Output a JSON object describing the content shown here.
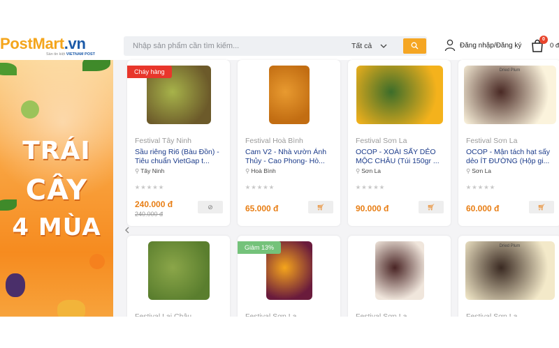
{
  "header": {
    "logo_text_a": "PostMart",
    "logo_text_b": ".vn",
    "logo_sub_pre": "Sàn tin kiệt",
    "logo_sub": "VIETNAM POST",
    "search_placeholder": "Nhập sản phẩm cần tìm kiếm...",
    "category": "Tất cả",
    "account_label": "Đăng nhập/Đăng ký",
    "cart_count": "0",
    "cart_total": "0 đ"
  },
  "banner": {
    "line1": "TRÁI",
    "line2": "CÂY",
    "line3": "4 MÙA"
  },
  "products": [
    {
      "festival": "Festival Tây Ninh",
      "name": "Sầu riêng Ri6 (Bàu Đồn) - Tiêu chuẩn VietGap t...",
      "location": "Tây Ninh",
      "price": "240.000 đ",
      "old_price": "240.000 đ",
      "tag": "Cháy hàng",
      "button": "ban"
    },
    {
      "festival": "Festival Hoà Bình",
      "name": "Cam V2 - Nhà vườn Ánh Thủy - Cao Phong- Hò...",
      "location": "Hoà Bình",
      "price": "65.000 đ",
      "old_price": "",
      "tag": "",
      "button": "cart"
    },
    {
      "festival": "Festival Sơn La",
      "name": "OCOP - XOÀI SẤY DẺO MỘC CHÂU (Túi 150gr ...",
      "location": "Sơn La",
      "price": "90.000 đ",
      "old_price": "",
      "tag": "",
      "button": "cart"
    },
    {
      "festival": "Festival Sơn La",
      "name": "OCOP - Mận tách hạt sấy dẻo ÍT ĐƯỜNG (Hộp gi...",
      "location": "Sơn La",
      "price": "60.000 đ",
      "old_price": "",
      "tag": "",
      "button": "cart"
    },
    {
      "festival": "Festival Lai Châu",
      "tag": ""
    },
    {
      "festival": "Festival Sơn La",
      "tag": "Giảm 13%"
    },
    {
      "festival": "Festival Sơn La",
      "tag": ""
    },
    {
      "festival": "Festival Sơn La",
      "tag": ""
    }
  ],
  "product_images": [
    {
      "label": "",
      "colors": [
        "#6c5a2a",
        "#a7b34a"
      ]
    },
    {
      "label": "",
      "colors": [
        "#c26d12",
        "#e89a30"
      ]
    },
    {
      "label": "",
      "colors": [
        "#f4b21c",
        "#3c6d2a"
      ]
    },
    {
      "label": "Dried Plum",
      "colors": [
        "#fbf3dc",
        "#4a2a25"
      ]
    },
    {
      "label": "",
      "colors": [
        "#5a7e2e",
        "#8ba649"
      ]
    },
    {
      "label": "",
      "colors": [
        "#6a1b3c",
        "#f5a51c"
      ]
    },
    {
      "label": "",
      "colors": [
        "#f0e6dc",
        "#4a2525"
      ]
    },
    {
      "label": "Dried Plum",
      "colors": [
        "#f3e9c9",
        "#3a2a22"
      ]
    }
  ],
  "colors": {
    "brand_orange": "#f4a51c",
    "brand_blue": "#1c5aa8",
    "price": "#e87e14",
    "hot_tag": "#e8362b",
    "sale_tag": "#74c27a"
  },
  "icons": {
    "search": "search-icon",
    "account": "user-icon",
    "cart": "cart-icon",
    "pin": "map-pin-icon",
    "chevron": "chevron-down-icon",
    "arrow": "arrow-left-icon"
  }
}
